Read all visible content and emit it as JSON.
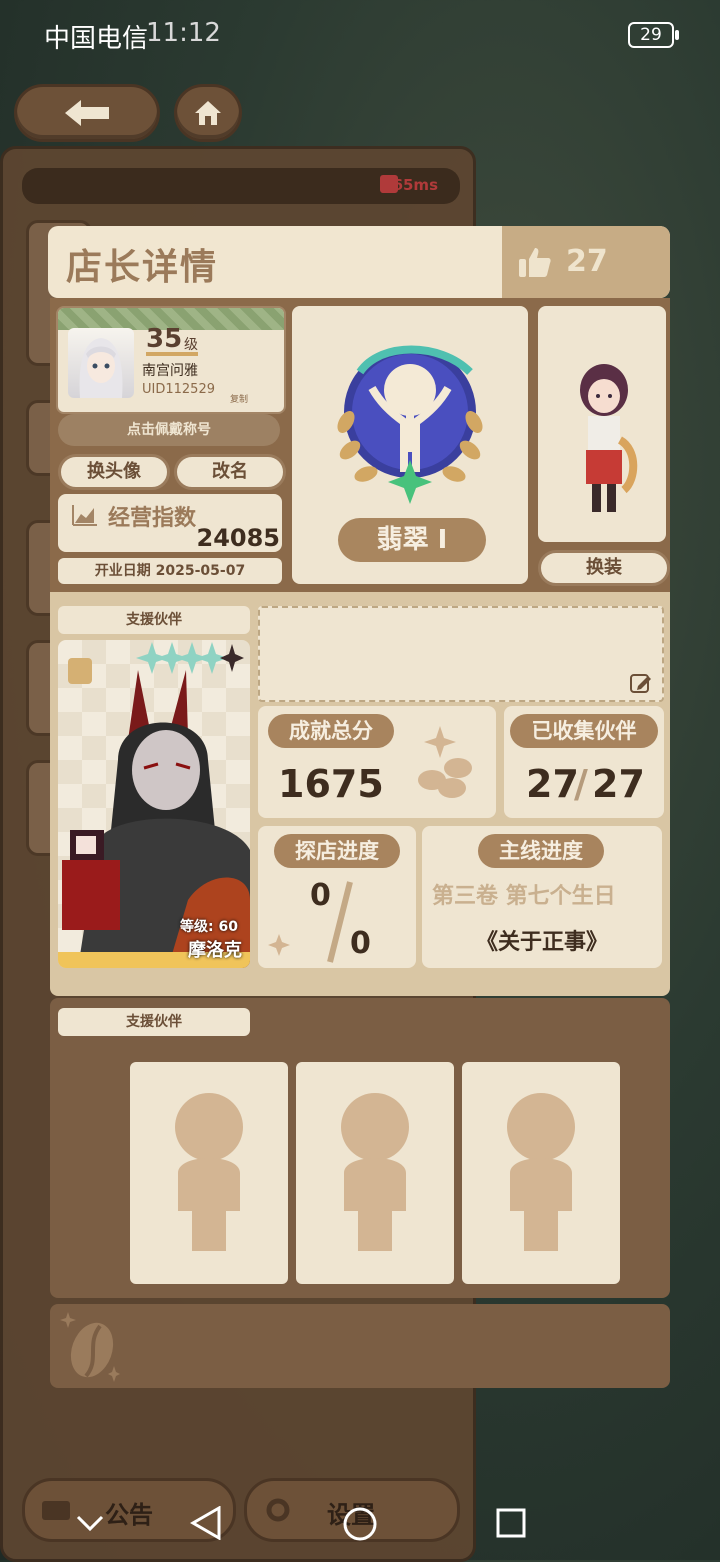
{
  "status_bar": {
    "carrier": "中国电信",
    "time": "11:12",
    "battery": "29"
  },
  "top_nav": {
    "back_icon": "back-arrow-icon",
    "home_icon": "home-icon"
  },
  "network": {
    "ping": "65ms"
  },
  "header": {
    "title": "店长详情",
    "likes": "27"
  },
  "profile": {
    "level": "35",
    "level_unit": "级",
    "name": "南宫问雅",
    "uid": "UID112529",
    "copy_label": "复制",
    "title_hint": "点击佩戴称号",
    "change_avatar": "换头像",
    "rename": "改名",
    "business_label": "经营指数",
    "business_value": "24085",
    "open_date": "开业日期 2025-05-07"
  },
  "badge": {
    "rank": "翡翠 I"
  },
  "character": {
    "change_outfit": "换装"
  },
  "support": {
    "label": "支援伙伴",
    "partner_level": "等级: 60",
    "partner_name": "摩洛克",
    "stars": 4
  },
  "stats": {
    "achievement_label": "成就总分",
    "achievement_value": "1675",
    "collected_label": "已收集伙伴",
    "collected_value": "27",
    "collected_total": "27",
    "explore_label": "探店进度",
    "explore_value": "0",
    "explore_total": "0",
    "main_label": "主线进度",
    "main_chapter": "第三卷 第七个生日",
    "main_title": "《关于正事》"
  },
  "support2": {
    "label": "支援伙伴"
  },
  "bottom_buttons": {
    "notice": "公告",
    "settings": "设置"
  },
  "colors": {
    "cream": "#efe5d1",
    "brown": "#7b5e44",
    "accent": "#a8845e"
  }
}
